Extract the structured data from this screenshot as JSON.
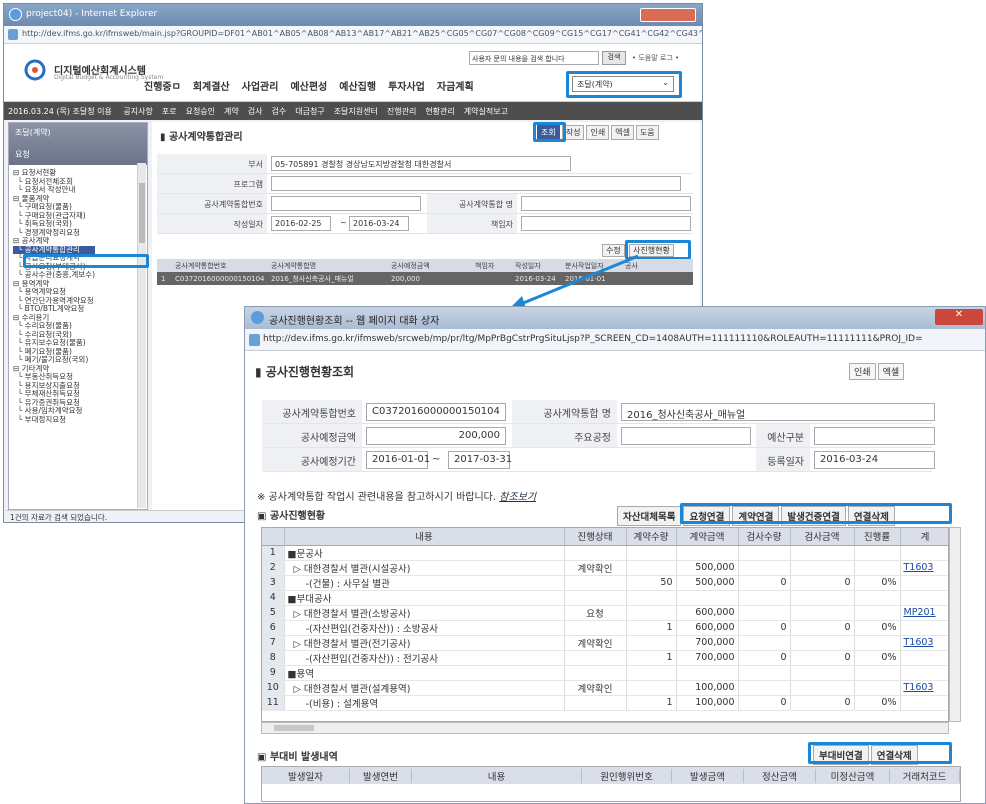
{
  "win1": {
    "title": "project04) - Internet Explorer",
    "address": "http://dev.ifms.go.kr/ifmsweb/main.jsp?GROUPID=DF01^AB01^AB05^AB08^AB13^AB17^AB21^AB25^CG05^CG07^CG08^CG09^CG15^CG17^CG41^CG42^CG43^CG44^CG47^C",
    "logo_text": "디지털예산회계시스템",
    "logo_sub": "Digital Budget & Accounting System",
    "menu": [
      "진행중ㅁ",
      "회계결산",
      "사업관리",
      "예산편성",
      "예산집행",
      "투자사업",
      "자금계획"
    ],
    "search_placeholder": "사용자 문의 내용을 검색 합니다",
    "search_button": "검색",
    "header_links": "• 도움말   로그 •",
    "org_select": "조달(계약)",
    "sub_date": "2016.03.24 (목) 조달청 이용",
    "submenu": [
      "공지사항",
      "포로",
      "요청승인",
      "계약",
      "검사",
      "검수",
      "대금청구",
      "조달지원센터",
      "진행관리",
      "현황관리",
      "계약실적보고"
    ],
    "side_title": "조달(계약)",
    "side_sub": "요청",
    "tree": [
      "⊟ 요청서현황",
      "  └ 요청서전체조회",
      "  └ 요청서 작성안내",
      "⊟ 물품계약",
      "  └ 구매요청(물품)",
      "  └ 구매요청(관급자재)",
      "  └ 취득요청(국외)",
      "  └ 경쟁계약정리요청",
      "⊟ 공사계약",
      "  └ 공사계약통합관리",
      "  └ 자급분리요청계약",
      "  └ 공사요청(부대공사)",
      "  └ 공사수관(중흥,계보수)",
      "⊟ 용역계약",
      "  └ 용역계약요청",
      "  └ 연간단가용역계약요청",
      "  └ BTO/BTL계약요청",
      "⊟ 수리용기",
      "  └ 수리요청(물품)",
      "  └ 수리요청(국외)",
      "  └ 유지보수요청(물품)",
      "  └ 폐기요청(물품)",
      "  └ 폐기/불기요청(국외)",
      "⊟ 기타계약",
      "  └ 부동산취득요청",
      "  └ 용지보상지출요청",
      "  └ 무체재산취득요청",
      "  └ 유가증권취득요청",
      "  └ 사용/임차계약요청",
      "  └ 부대정지요청"
    ],
    "tree_selected": "공사계약통합관리",
    "status": "1건의 자료가 검색 되었습니다.",
    "page_title": "공사계약통합관리",
    "buttons": [
      "조회",
      "작성",
      "인쇄",
      "엑셀",
      "도움"
    ],
    "form": {
      "dept_label": "부서",
      "dept_value": "05-705891 경찰청 경상남도지방경찰청 대한경찰서",
      "program_label": "프로그램",
      "contract_no_label": "공사계약통합번호",
      "contract_name_label": "공사계약통합 명",
      "date_label": "작성일자",
      "date_from": "2016-02-25",
      "date_to": "2016-03-24",
      "writer_label": "책임자"
    },
    "btn_edit": "수정",
    "btn_progress": "사진행현황",
    "table_headers": [
      "공사계약통합번호",
      "공사계약통합명",
      "공사예정금액",
      "책임자",
      "작성일자",
      "분사작업일자",
      "공사"
    ],
    "table_row": [
      "1",
      "C0372016000000150104",
      "2016_청사신축공사_매뉴얼",
      "200,000",
      "",
      "2016-03-24",
      "2016-01-01"
    ]
  },
  "win2": {
    "title": "공사진행현황조회 -- 웹 페이지 대화 상자",
    "address": "http://dev.ifms.go.kr/ifmsweb/srcweb/mp/pr/ltg/MpPrBgCstrPrgSituLjsp?P_SCREEN_CD=1408AUTH=111111110&ROLEAUTH=11111111&PROJ_ID=",
    "page_title": "공사진행현황조회",
    "btn_print": "인쇄",
    "btn_excel": "엑셀",
    "form": {
      "no_label": "공사계약통합번호",
      "no_value": "C0372016000000150104",
      "name_label": "공사계약통합 명",
      "name_value": "2016_청사신축공사_매뉴얼",
      "amount_label": "공사예정금액",
      "amount_value": "200,000",
      "main_label": "주요공정",
      "budget_label": "예산구분",
      "period_label": "공사예정기간",
      "period_from": "2016-01-01",
      "period_to": "2017-03-31",
      "reg_label": "등록일자",
      "reg_value": "2016-03-24"
    },
    "note": "※ 공사계약통합 작업시 관련내용을 참고하시기 바랍니다.",
    "note_link": "참조보기",
    "section1": "공사진행현황",
    "section1_buttons": [
      "자산대체목록",
      "요청연결",
      "계약연결",
      "발생건중연결",
      "연결삭제"
    ],
    "grid_headers": [
      "",
      "내용",
      "진행상태",
      "계약수량",
      "계약금액",
      "검사수량",
      "검사금액",
      "진행률",
      "계"
    ],
    "rows": [
      [
        "1",
        "■문공사",
        "",
        "",
        "",
        "",
        "",
        "",
        ""
      ],
      [
        "2",
        "  ▷ 대한경찰서 별관(시설공사)",
        "계약확인",
        "",
        "500,000",
        "",
        "",
        "",
        "T1603"
      ],
      [
        "3",
        "      -(건물) : 사무실 별관",
        "",
        "50",
        "500,000",
        "0",
        "0",
        "0%",
        ""
      ],
      [
        "4",
        "■부대공사",
        "",
        "",
        "",
        "",
        "",
        "",
        ""
      ],
      [
        "5",
        "  ▷ 대한경찰서 별관(소방공사)",
        "요청",
        "",
        "600,000",
        "",
        "",
        "",
        "MP201"
      ],
      [
        "6",
        "      -(자산편입(건중자산)) : 소방공사",
        "",
        "1",
        "600,000",
        "0",
        "0",
        "0%",
        ""
      ],
      [
        "7",
        "  ▷ 대한경찰서 별관(전기공사)",
        "계약확인",
        "",
        "700,000",
        "",
        "",
        "",
        "T1603"
      ],
      [
        "8",
        "      -(자산편입(건중자산)) : 전기공사",
        "",
        "1",
        "700,000",
        "0",
        "0",
        "0%",
        ""
      ],
      [
        "9",
        "■용역",
        "",
        "",
        "",
        "",
        "",
        "",
        ""
      ],
      [
        "10",
        "  ▷ 대한경찰서 별관(설계용역)",
        "계약확인",
        "",
        "100,000",
        "",
        "",
        "",
        "T1603"
      ],
      [
        "11",
        "      -(비용) : 설계용역",
        "",
        "1",
        "100,000",
        "0",
        "0",
        "0%",
        ""
      ]
    ],
    "section2": "부대비 발생내역",
    "section2_buttons": [
      "부대비연결",
      "연결삭제"
    ],
    "grid2_headers": [
      "발생일자",
      "발생연번",
      "내용",
      "원인행위번호",
      "발생금액",
      "정산금액",
      "미정산금액",
      "거래처코드"
    ]
  },
  "colors": {
    "highlight": "#1c86d6",
    "dark_row": "#656565",
    "header_bg": "#d9dee8"
  }
}
